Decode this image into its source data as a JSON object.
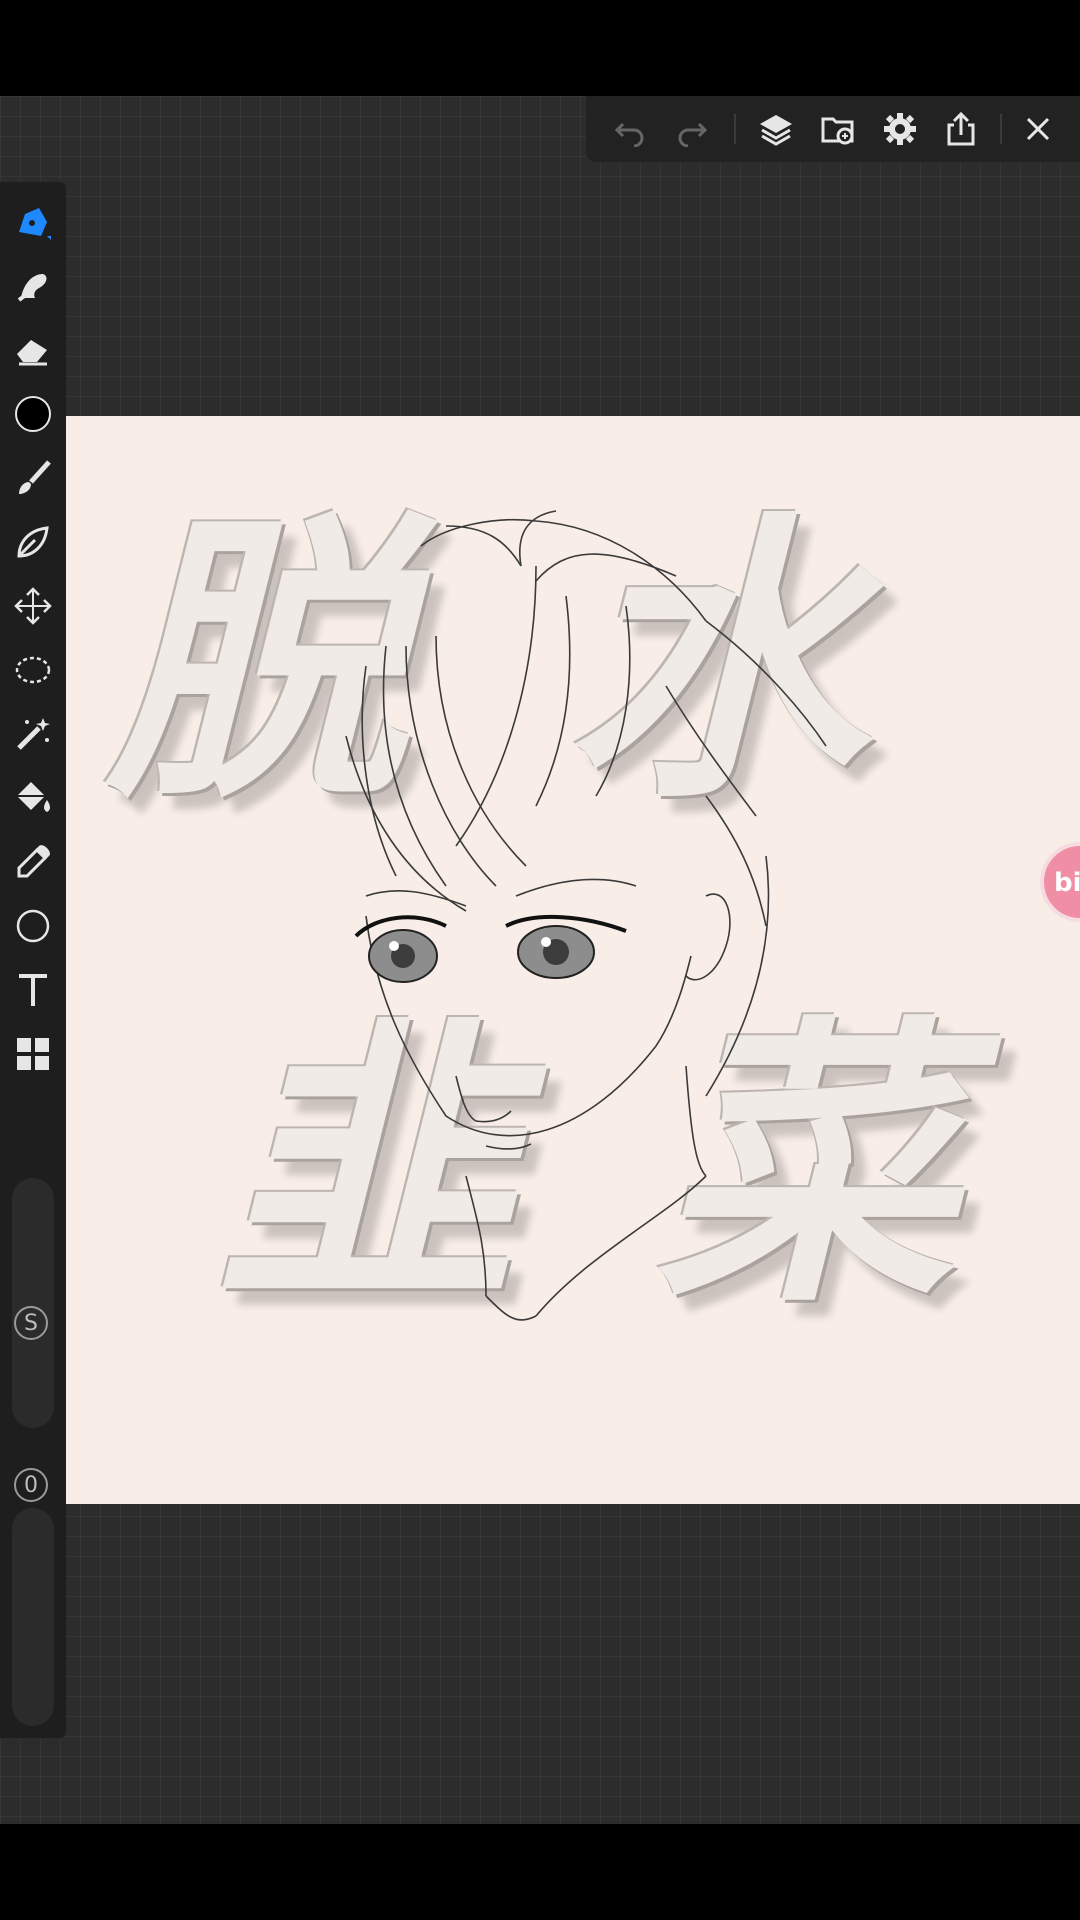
{
  "toolbar": {
    "icons": [
      "undo-icon",
      "redo-icon",
      "layers-icon",
      "import-image-icon",
      "settings-icon",
      "share-icon",
      "close-icon"
    ]
  },
  "tools": {
    "icons": [
      "pen-icon",
      "smudge-icon",
      "eraser-icon",
      "color-swatch",
      "brush-icon",
      "pen-nib-icon",
      "transform-icon",
      "lasso-icon",
      "magic-wand-icon",
      "fill-icon",
      "eyedropper-icon",
      "shape-icon",
      "text-icon",
      "grid-icon"
    ],
    "size_badge": "S",
    "opacity_badge": "0",
    "active_color": "#000000",
    "accent_color": "#1e88ff"
  },
  "canvas": {
    "watermark": [
      "脱",
      "水",
      "韭",
      "菜"
    ],
    "background_color": "#f8ede7"
  },
  "floating_button": {
    "label": "bili"
  }
}
